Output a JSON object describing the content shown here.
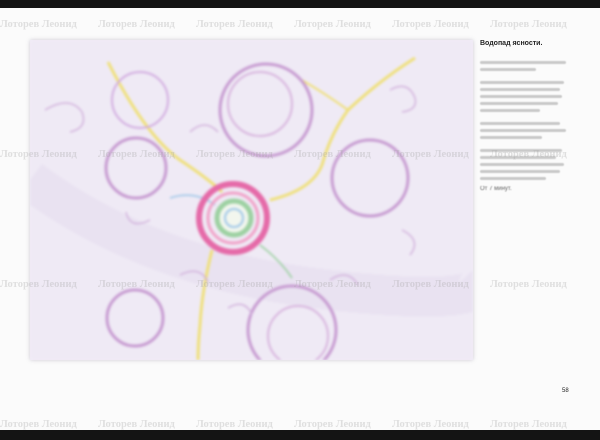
{
  "watermark": "Лоторев Леонид",
  "sidebar": {
    "title": "Водопад ясности.",
    "final_line": "От 7 минут."
  },
  "page_number": "58",
  "colors": {
    "page_background": "#fbfbfb",
    "drawing_paper": "#f1edf6",
    "outer_frame": "#141414",
    "circle_purple": "#c79bd1",
    "ring_pink": "#e56aa8",
    "stream_yellow": "#efe07a",
    "accent_green": "#9dd1a2",
    "accent_blue": "#9fc7e8"
  }
}
